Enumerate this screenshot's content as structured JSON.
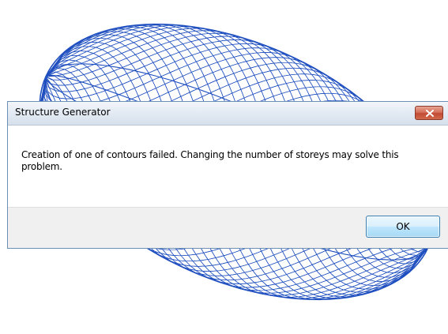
{
  "background": {
    "shape": "wireframe ellipsoid",
    "stroke_color": "#1f4fbf"
  },
  "dialog": {
    "title": "Structure Generator",
    "message": "Creation of one of contours failed. Changing the number of storeys may solve this problem.",
    "ok_label": "OK",
    "close_icon": "close-icon",
    "close_color": "#c7533b"
  }
}
